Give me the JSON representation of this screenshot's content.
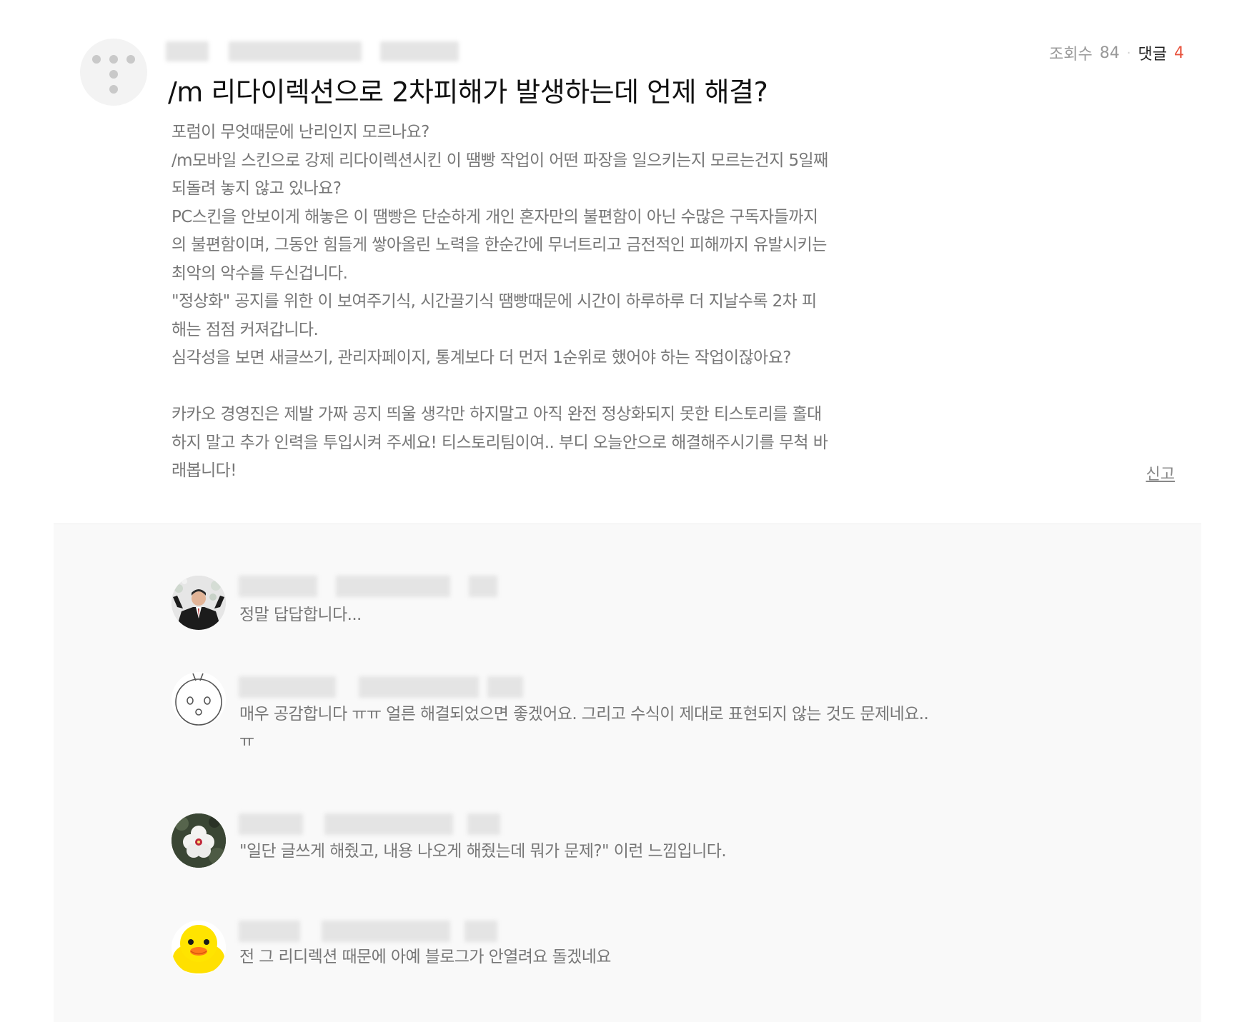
{
  "post": {
    "stats": {
      "views_label": "조회수",
      "views": "84",
      "separator": "·",
      "comments_label": "댓글",
      "comments": "4"
    },
    "title": "/m 리다이렉션으로 2차피해가 발생하는데 언제 해결?",
    "body": [
      "포럼이 무엇때문에 난리인지 모르나요?",
      "/m모바일 스킨으로 강제 리다이렉션시킨 이 땜빵 작업이 어떤 파장을 일으키는지 모르는건지 5일째",
      "되돌려 놓지 않고 있나요?",
      "PC스킨을 안보이게 해놓은 이 땜빵은 단순하게 개인 혼자만의 불편함이 아닌 수많은 구독자들까지",
      "의 불편함이며, 그동안 힘들게 쌓아올린 노력을 한순간에 무너트리고 금전적인 피해까지 유발시키는",
      "최악의 악수를 두신겁니다.",
      "\"정상화\" 공지를 위한 이 보여주기식, 시간끌기식 땜빵때문에 시간이 하루하루 더 지날수록 2차 피",
      "해는 점점 커져갑니다.",
      "심각성을 보면 새글쓰기, 관리자페이지, 통계보다 더 먼저 1순위로 했어야 하는 작업이잖아요?",
      "",
      "카카오 경영진은 제발 가짜 공지 띄울 생각만 하지말고 아직 완전 정상화되지 못한 티스토리를 홀대",
      "하지 말고 추가 인력을 투입시켜 주세요! 티스토리팀이여.. 부디 오늘안으로 해결해주시기를 무척 바",
      "래봅니다!"
    ],
    "report_label": "신고"
  },
  "comments": [
    {
      "avatar": "suit-man-avatar",
      "lines": [
        "정말 답답합니다..."
      ]
    },
    {
      "avatar": "line-drawing-face-avatar",
      "lines": [
        "매우 공감합니다 ㅠㅠ 얼른 해결되었으면 좋겠어요. 그리고 수식이 제대로 표현되지 않는 것도 문제네요..",
        "ㅠ"
      ]
    },
    {
      "avatar": "white-flower-avatar",
      "lines": [
        "\"일단 글쓰게 해줬고, 내용 나오게 해줬는데 뭐가 문제?\" 이런 느낌입니다."
      ]
    },
    {
      "avatar": "yellow-duck-avatar",
      "lines": [
        "전 그 리디렉션 때문에 아예 블로그가 안열려요 돌겠네요"
      ]
    }
  ]
}
